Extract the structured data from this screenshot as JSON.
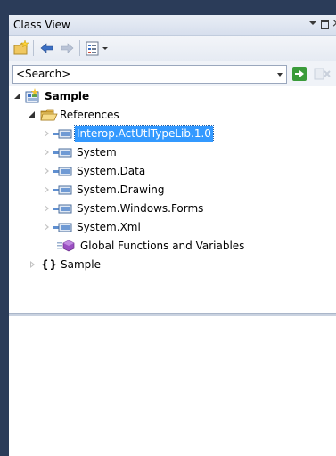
{
  "window": {
    "title": "Class View",
    "dropdown_icon": "chevron-down-icon",
    "restore_icon": "restore-icon",
    "close_glyph": "×"
  },
  "toolbar": {
    "buttons": [
      {
        "name": "new-folder-button",
        "icon": "new-folder-icon"
      },
      {
        "name": "back-button",
        "icon": "back-arrow-icon"
      },
      {
        "name": "forward-button",
        "icon": "forward-arrow-icon"
      },
      {
        "name": "settings-button",
        "icon": "settings-icon"
      }
    ]
  },
  "search": {
    "value": "<Search>"
  },
  "tree": {
    "root": {
      "label": "Sample"
    },
    "references": {
      "label": "References"
    },
    "items": [
      {
        "label": "Interop.ActUtlTypeLib.1.0",
        "selected": true
      },
      {
        "label": "System",
        "selected": false
      },
      {
        "label": "System.Data",
        "selected": false
      },
      {
        "label": "System.Drawing",
        "selected": false
      },
      {
        "label": "System.Windows.Forms",
        "selected": false
      },
      {
        "label": "System.Xml",
        "selected": false
      }
    ],
    "globals": {
      "label": "Global Functions and Variables"
    },
    "namespace": {
      "label": "Sample",
      "glyph": "{}"
    }
  },
  "colors": {
    "selection": "#3399ff",
    "frame": "#2b3c59"
  }
}
